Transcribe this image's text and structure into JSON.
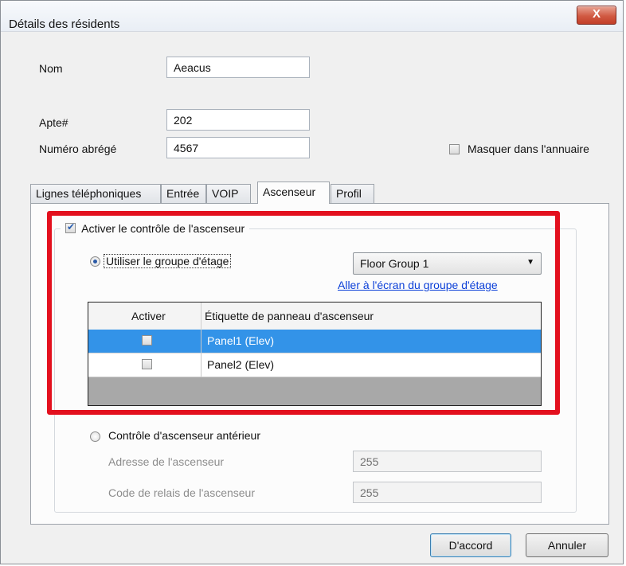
{
  "window": {
    "title": "Détails des résidents",
    "close_glyph": "X"
  },
  "fields": {
    "nom": {
      "label": "Nom",
      "value": "Aeacus"
    },
    "apte": {
      "label": "Apte#",
      "value": "202"
    },
    "numero": {
      "label": "Numéro abrégé",
      "value": "4567"
    },
    "masquer": {
      "label": "Masquer dans l'annuaire",
      "checked": false
    }
  },
  "tabs": [
    {
      "label": "Lignes téléphoniques"
    },
    {
      "label": "Entrée"
    },
    {
      "label": "VOIP"
    },
    {
      "label": "Ascenseur",
      "active": true
    },
    {
      "label": "Profil"
    }
  ],
  "ascenseur": {
    "enable_label": "Activer le contrôle de l'ascenseur",
    "enable_checked": true,
    "use_floor_group_label": "Utiliser le groupe d'étage",
    "floor_group_selected": "Floor Group 1",
    "goto_link": "Aller à l'écran du groupe d'étage",
    "grid": {
      "columns": [
        "Activer",
        "Étiquette de panneau d'ascenseur"
      ],
      "rows": [
        {
          "enabled": false,
          "label": "Panel1 (Elev)",
          "selected": true
        },
        {
          "enabled": false,
          "label": "Panel2 (Elev)",
          "selected": false
        }
      ]
    },
    "legacy_label": "Contrôle d'ascenseur antérieur",
    "address_label": "Adresse de l'ascenseur",
    "address_value": "255",
    "relay_label": "Code de relais de l'ascenseur",
    "relay_value": "255"
  },
  "buttons": {
    "ok": "D'accord",
    "cancel": "Annuler"
  },
  "colors": {
    "highlight": "#e3101e",
    "selection": "#3393e8",
    "link": "#0b3fd8"
  }
}
